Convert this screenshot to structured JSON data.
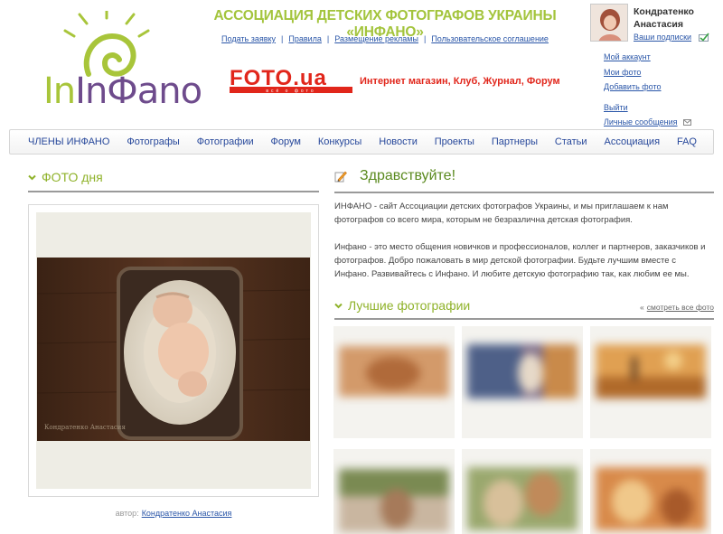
{
  "header": {
    "logo_text": "InФano",
    "site_title": "АССОЦИАЦИЯ ДЕТСКИХ ФОТОГРАФОВ УКРАИНЫ «ИНФАНО»",
    "top_links": [
      "Подать заявку",
      "Правила",
      "Размещение рекламы",
      "Пользовательское соглашение"
    ],
    "banner_logo": "FOTO.ua",
    "banner_logo_sub": "всё о фото",
    "banner_slogan": "Интернет магазин, Клуб, Журнал, Форум"
  },
  "user": {
    "name": "Кондратенко Анастасия",
    "subscriptions": "Ваши подписки",
    "menu": [
      "Мой аккаунт",
      "Мои фото",
      "Добавить фото",
      "Выйти",
      "Личные сообщения"
    ]
  },
  "nav": [
    "ЧЛЕНЫ ИНФАНО",
    "Фотографы",
    "Фотографии",
    "Форум",
    "Конкурсы",
    "Новости",
    "Проекты",
    "Партнеры",
    "Статьи",
    "Ассоциация",
    "FAQ"
  ],
  "photo_of_day": {
    "title": "ФОТО дня",
    "author_label": "автор:",
    "author_name": "Кондратенко Анастасия"
  },
  "welcome": {
    "title": "Здравствуйте!",
    "paragraph1": "ИНФАНО - сайт Ассоциации детских фотографов Украины, и мы приглашаем к нам фотографов со всего мира, которым не безразлична детская фотография.",
    "paragraph2": "Инфано - это место общения новичков и профессионалов, коллег и партнеров, заказчиков и фотографов.  Добро пожаловать в мир детской фотографии. Будьте лучшим вместе с Инфано. Развивайтесь с Инфано. И любите детскую фотографию так, как любим ее мы."
  },
  "best_photos": {
    "title": "Лучшие  фотографии",
    "view_all": "смотреть все фото",
    "view_all_marker": "«",
    "thumb_tones": [
      "#d39a6a",
      "#7a6a86",
      "#e0a052",
      "#c9b6a0",
      "#9aa86e",
      "#d88a4a"
    ]
  },
  "colors": {
    "brand_green": "#a3c43c",
    "link_blue": "#2a56a8",
    "banner_red": "#e1261b"
  }
}
